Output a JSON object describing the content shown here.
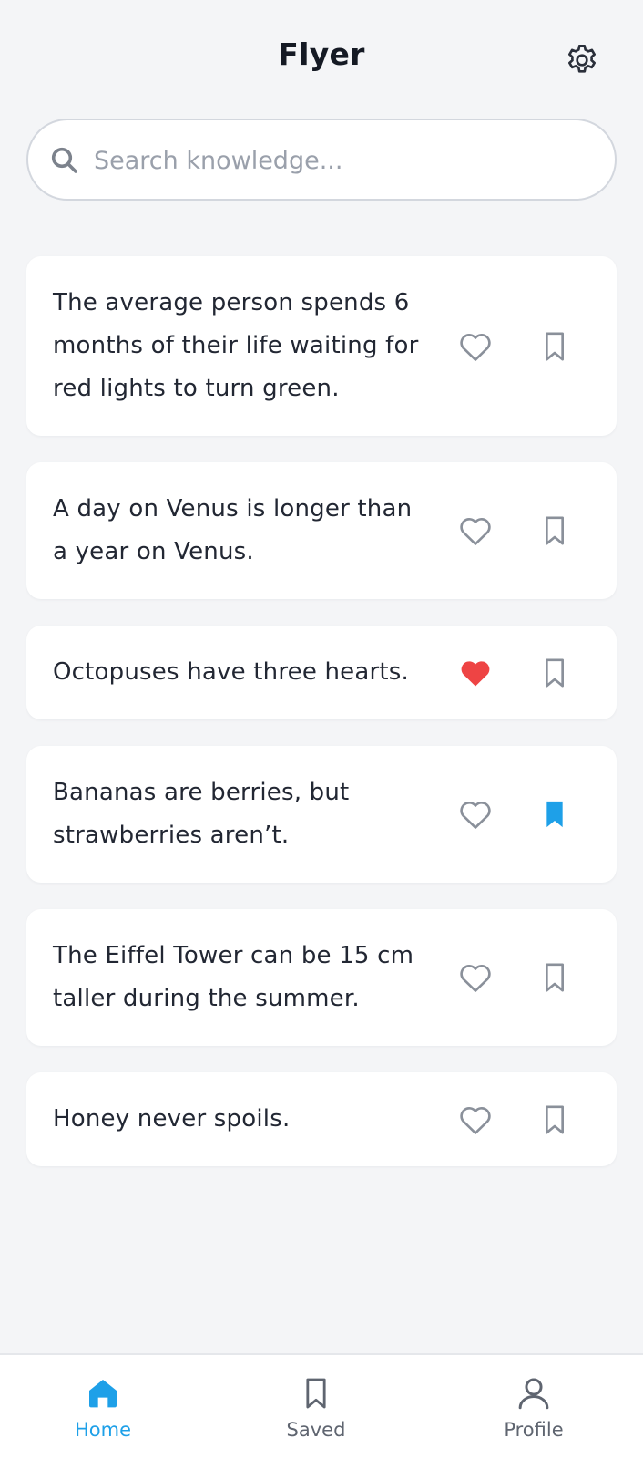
{
  "header": {
    "title": "Flyer",
    "settings_icon": "gear-icon"
  },
  "search": {
    "placeholder": "Search knowledge...",
    "value": "",
    "icon": "search-icon"
  },
  "facts": [
    {
      "text": "The average person spends 6 months of their life waiting for red lights to turn green.",
      "liked": false,
      "saved": false
    },
    {
      "text": "A day on Venus is longer than a year on Venus.",
      "liked": false,
      "saved": false
    },
    {
      "text": "Octopuses have three hearts.",
      "liked": true,
      "saved": false
    },
    {
      "text": "Bananas are berries, but strawberries aren’t.",
      "liked": false,
      "saved": true
    },
    {
      "text": "The Eiffel Tower can be 15 cm taller during the summer.",
      "liked": false,
      "saved": false
    },
    {
      "text": "Honey never spoils.",
      "liked": false,
      "saved": false
    }
  ],
  "bottom_nav": {
    "items": [
      {
        "label": "Home",
        "icon": "home-icon",
        "active": true
      },
      {
        "label": "Saved",
        "icon": "bookmark-icon",
        "active": false
      },
      {
        "label": "Profile",
        "icon": "user-icon",
        "active": false
      }
    ]
  },
  "colors": {
    "accent": "#1ea0e8",
    "like_active": "#ee4444",
    "icon_inactive": "#8a909a",
    "background": "#f4f5f7",
    "card": "#ffffff"
  }
}
